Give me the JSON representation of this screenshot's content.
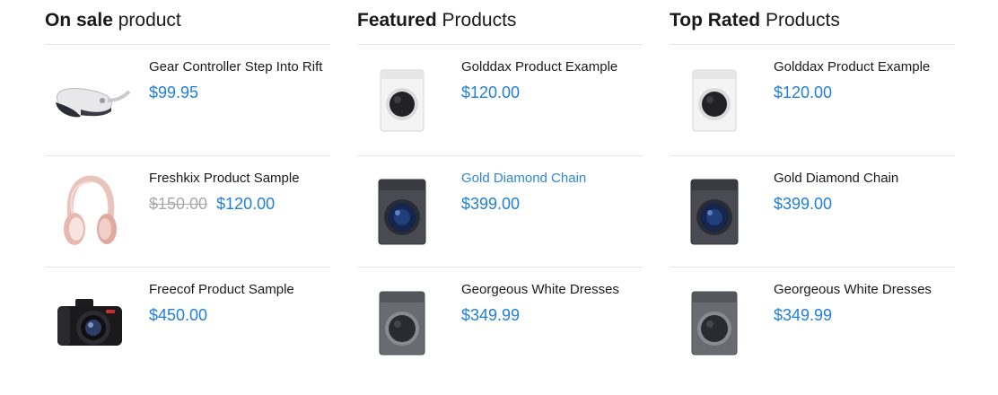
{
  "columns": [
    {
      "title_strong": "On sale",
      "title_light": "product",
      "items": [
        {
          "name": "Gear Controller Step Into Rift",
          "price": "$99.95",
          "image": "vr-headset-icon"
        },
        {
          "name": "Freshkix Product Sample",
          "old_price": "$150.00",
          "price": "$120.00",
          "image": "headphones-icon"
        },
        {
          "name": "Freecof Product Sample",
          "price": "$450.00",
          "image": "camera-icon"
        }
      ]
    },
    {
      "title_strong": "Featured",
      "title_light": "Products",
      "items": [
        {
          "name": "Golddax Product Example",
          "price": "$120.00",
          "image": "white-washer-icon"
        },
        {
          "name": "Gold Diamond Chain",
          "price": "$399.00",
          "image": "dark-washer-icon",
          "highlighted": true
        },
        {
          "name": "Georgeous White Dresses",
          "price": "$349.99",
          "image": "grey-washer-icon"
        }
      ]
    },
    {
      "title_strong": "Top Rated",
      "title_light": "Products",
      "items": [
        {
          "name": "Golddax Product Example",
          "price": "$120.00",
          "image": "white-washer-icon"
        },
        {
          "name": "Gold Diamond Chain",
          "price": "$399.00",
          "image": "dark-washer-icon"
        },
        {
          "name": "Georgeous White Dresses",
          "price": "$349.99",
          "image": "grey-washer-icon"
        }
      ]
    }
  ],
  "colors": {
    "price": "#1f7fd8",
    "link_hover": "#2f86d8",
    "old_price": "#a8a8a8",
    "divider": "#e6e6e6"
  }
}
